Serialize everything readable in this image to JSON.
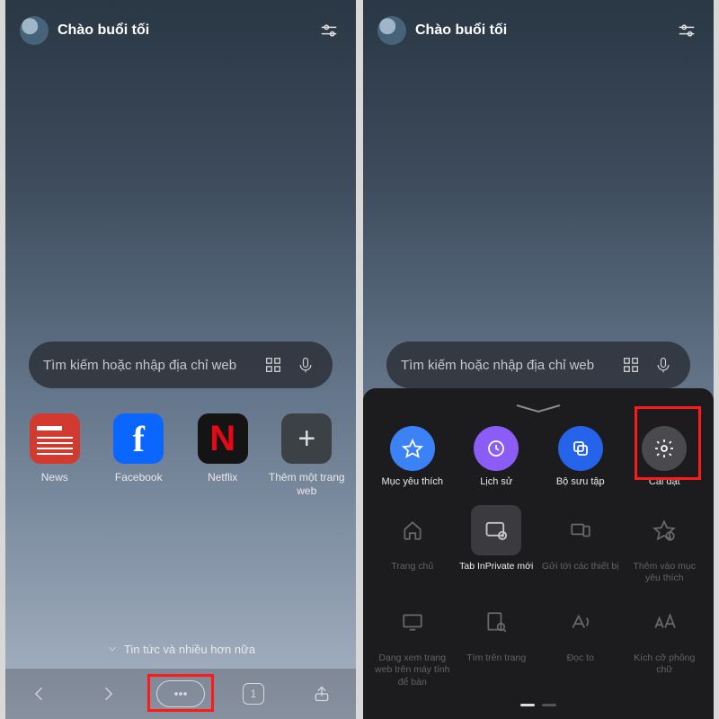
{
  "greeting": "Chào buổi tối",
  "search": {
    "placeholder": "Tìm kiếm hoặc nhập địa chỉ web"
  },
  "shortcuts": [
    {
      "label": "News"
    },
    {
      "label": "Facebook"
    },
    {
      "label": "Netflix"
    },
    {
      "label": "Thêm một trang web"
    }
  ],
  "teaser": "Tin tức và nhiều hơn nữa",
  "tabcount": "1",
  "sheet": {
    "top": [
      {
        "label": "Mục yêu thích"
      },
      {
        "label": "Lịch sử"
      },
      {
        "label": "Bộ sưu tập"
      },
      {
        "label": "Cài đặt"
      }
    ],
    "grid": [
      {
        "label": "Trang chủ"
      },
      {
        "label": "Tab InPrivate mới"
      },
      {
        "label": "Gửi tới các thiết bị"
      },
      {
        "label": "Thêm vào mục yêu thích"
      },
      {
        "label": "Dạng xem trang web trên máy tính để bàn"
      },
      {
        "label": "Tìm trên trang"
      },
      {
        "label": "Đọc to"
      },
      {
        "label": "Kích cỡ phông chữ"
      }
    ]
  }
}
